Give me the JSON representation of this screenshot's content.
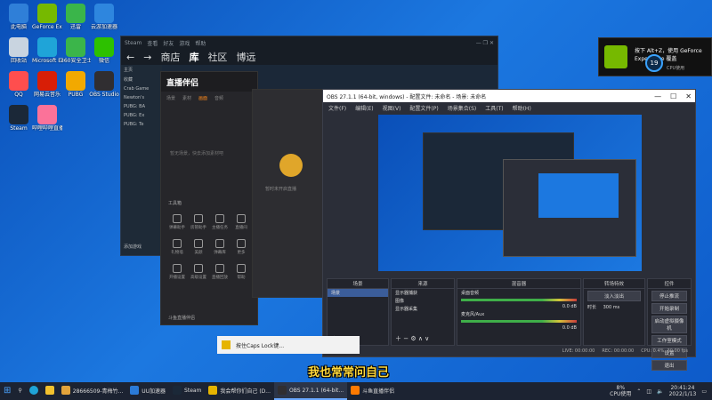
{
  "desktop_icons": [
    {
      "label": "此电脑",
      "color": "#2f7fd8"
    },
    {
      "label": "GeForce Experience",
      "color": "#76b900"
    },
    {
      "label": "迅雷",
      "color": "#3ab54a"
    },
    {
      "label": "云游加速器",
      "color": "#2e86de"
    },
    {
      "label": "回收站",
      "color": "#c9d4e0"
    },
    {
      "label": "Microsoft Edge",
      "color": "#1fa4d8"
    },
    {
      "label": "360安全卫士",
      "color": "#3bb54a"
    },
    {
      "label": "微信",
      "color": "#2dc100"
    },
    {
      "label": "QQ",
      "color": "#ff4e4e"
    },
    {
      "label": "网易云音乐",
      "color": "#d81e06"
    },
    {
      "label": "PUBG",
      "color": "#f2a900"
    },
    {
      "label": "OBS Studio",
      "color": "#302e31"
    },
    {
      "label": "Steam",
      "color": "#1b2838"
    },
    {
      "label": "哔哩哔哩直播姬",
      "color": "#fb7299"
    }
  ],
  "steam": {
    "nav": [
      "←",
      "→",
      "商店",
      "库",
      "社区",
      "博远"
    ],
    "side_rows": [
      "主页",
      "收藏",
      "Crab Game",
      "Newton's",
      "PUBG: BA",
      "PUBG: Ex",
      "PUBG: Te",
      "添加游戏"
    ]
  },
  "assistant": {
    "logo": "直播伴侣",
    "tabs": [
      "场景",
      "素材",
      "画面",
      "音频"
    ],
    "empty_text": "暂无场景，快去添加素材吧",
    "tools_title": "工具箱",
    "tools": [
      "弹幕助手",
      "房管助手",
      "主播任务",
      "直播间",
      "礼物墙",
      "美颜",
      "弹幕库",
      "更多",
      "开播设置",
      "高级设置",
      "直播回放",
      "帮助"
    ],
    "preview_tip": "暂时未开启直播",
    "bottom_text": "斗鱼直播伴侣"
  },
  "obs": {
    "title": "OBS 27.1.1 (64-bit, windows) - 配置文件: 未命名 - 场景: 未命名",
    "menu": [
      "文件(F)",
      "编辑(E)",
      "视图(V)",
      "配置文件(P)",
      "场景集合(S)",
      "工具(T)",
      "帮助(H)"
    ],
    "docks": {
      "scenes": {
        "title": "场景",
        "items": [
          "场景"
        ]
      },
      "sources": {
        "title": "来源",
        "items": [
          "显示器捕获",
          "图像",
          "显示器采集"
        ]
      },
      "mixer": {
        "title": "混音器",
        "tracks": [
          {
            "name": "桌面音频",
            "db": "0.0 dB"
          },
          {
            "name": "麦克风/Aux",
            "db": "0.0 dB"
          }
        ]
      },
      "transitions": {
        "title": "转场特效",
        "type": "淡入淡出",
        "duration_label": "时长",
        "duration": "300 ms"
      },
      "controls": {
        "title": "控件",
        "buttons": [
          "停止推流",
          "开始录制",
          "启动虚拟摄像机",
          "工作室模式",
          "设置",
          "退出"
        ]
      }
    },
    "status": {
      "live": "LIVE: 00:00:00",
      "rec": "REC: 00:00:00",
      "cpu": "CPU: 0.4%, 30.00 fps"
    }
  },
  "geforce": {
    "line1": "按下 Alt+Z，使用 GeForce",
    "line2": "Experience 覆盖",
    "temp": "19",
    "cpu_label": "CPU使用"
  },
  "taskbar": {
    "items": [
      {
        "label": "28666509-青梅竹...",
        "color": "#e2a33b"
      },
      {
        "label": "UU加速器",
        "color": "#2b7bd8"
      },
      {
        "label": "Steam",
        "color": "#1b2838"
      },
      {
        "label": "我会帮你们自己 (D...",
        "color": "#e6b400"
      },
      {
        "label": "OBS 27.1.1 (64-bit...",
        "color": "#302e31"
      },
      {
        "label": "斗鱼直播伴侣",
        "color": "#ff7a00"
      }
    ],
    "cpu": "8%",
    "cpu_label": "CPU使用",
    "time": "20:41:24",
    "date": "2022/1/13"
  },
  "caps_notice": "按住Caps Lock键...",
  "caption": "我也常常问自己"
}
